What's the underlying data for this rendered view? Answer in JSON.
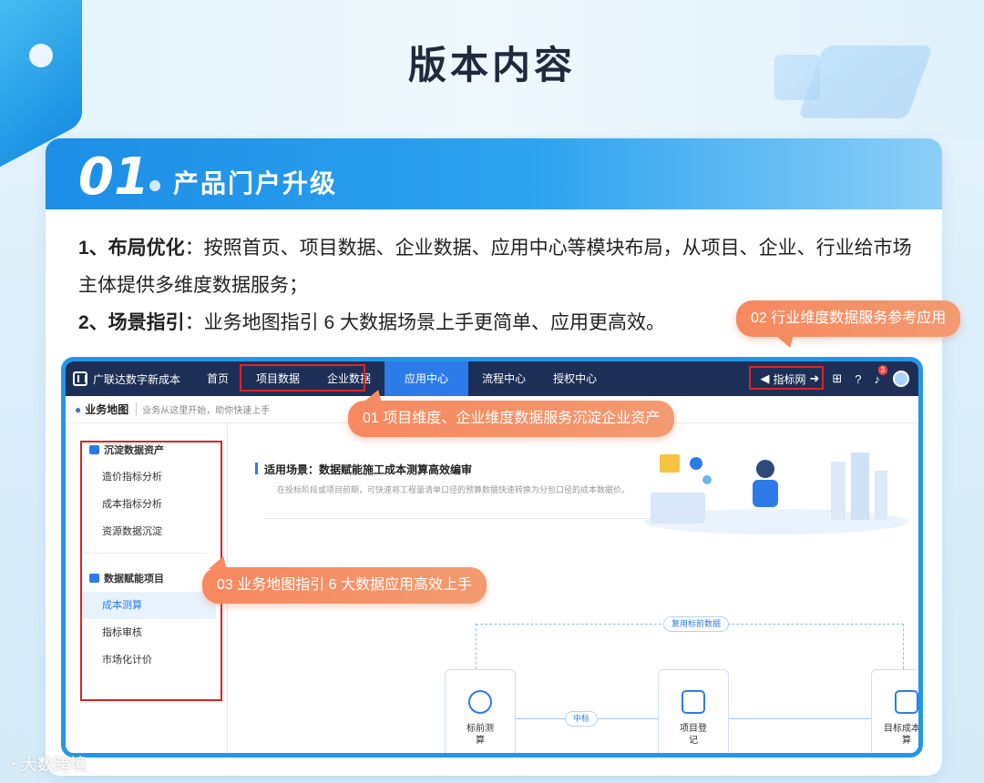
{
  "page_title": "版本内容",
  "section": {
    "number": "01",
    "heading": "产品门户升级"
  },
  "intro": {
    "p1_label": "1、布局优化",
    "p1_text": "：按照首页、项目数据、企业数据、应用中心等模块布局，从项目、企业、行业给市场主体提供多维度数据服务；",
    "p2_label": "2、场景指引",
    "p2_text": "：业务地图指引 6 大数据场景上手更简单、应用更高效。"
  },
  "callouts": {
    "c02": "02  行业维度数据服务参考应用",
    "c01": "01  项目维度、企业维度数据服务沉淀企业资产",
    "c03": "03  业务地图指引 6 大数据应用高效上手"
  },
  "app": {
    "brand": "广联达数字新成本",
    "nav": [
      "首页",
      "项目数据",
      "企业数据",
      "应用中心",
      "流程中心",
      "授权中心"
    ],
    "active_nav": "应用中心",
    "right_link": "指标网",
    "notification_count": "3",
    "subbar_title": "业务地图",
    "subbar_sub": "业务从这里开始，助你快速上手",
    "sidebar": {
      "group1": "沉淀数据资产",
      "group1_items": [
        "造价指标分析",
        "成本指标分析",
        "资源数据沉淀"
      ],
      "group2": "数据赋能项目",
      "group2_items": [
        "成本测算",
        "指标审核",
        "市场化计价"
      ]
    },
    "scene_title": "适用场景：数据赋能施工成本测算高效编审",
    "scene_desc": "在投标阶段或项目前期，可快速将工程量清单口径的预算数据快速转换为分包口径的成本数据价。",
    "flow": {
      "reuse_tag": "复用标前数据",
      "mid_tag": "中标",
      "node1": "标前测算",
      "node2": "项目登记",
      "node3": "目标成本测算"
    }
  },
  "watermark": "大数跨境",
  "colors": {
    "accent_blue": "#2396ea",
    "callout_orange": "#f78a60",
    "nav_dark": "#1d2f56",
    "highlight_red": "#e02323"
  }
}
